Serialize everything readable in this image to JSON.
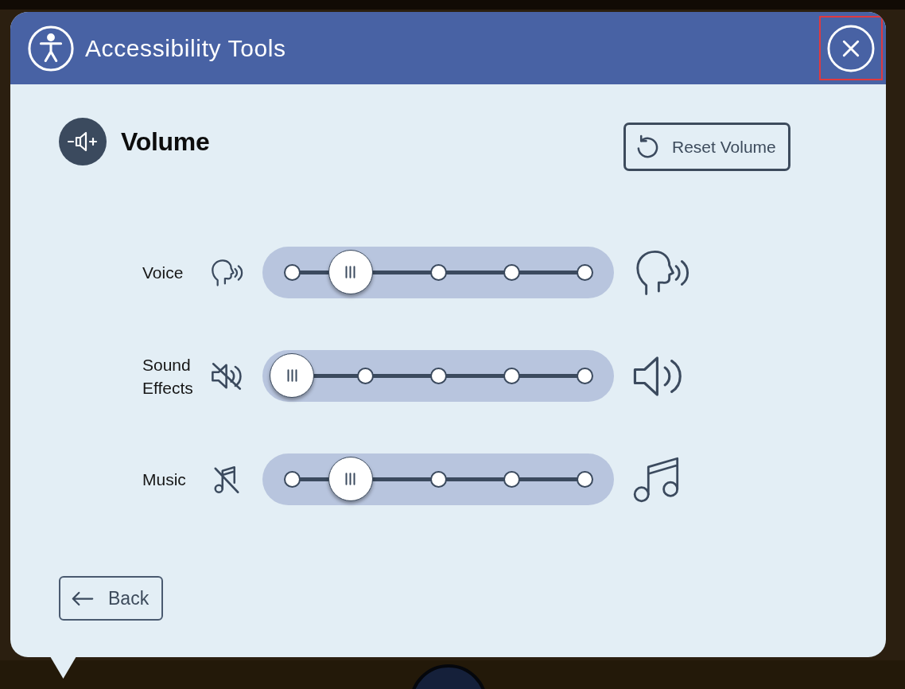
{
  "window": {
    "title": "Accessibility Tools",
    "close_button": {
      "highlighted": true
    }
  },
  "section": {
    "title": "Volume",
    "reset_button": {
      "label": "Reset Volume"
    }
  },
  "sliders": [
    {
      "label": "Voice",
      "kind": "voice",
      "level": 0.2
    },
    {
      "label": "Sound Effects",
      "kind": "sound",
      "level": 0
    },
    {
      "label": "Music",
      "kind": "music",
      "level": 0.2
    }
  ],
  "back_button": {
    "label": "Back"
  }
}
